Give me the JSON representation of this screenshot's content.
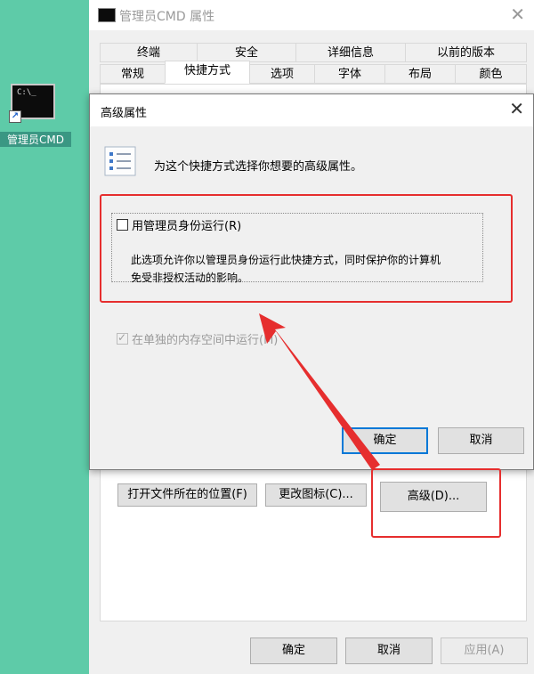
{
  "desktop": {
    "shortcut_label": "管理员CMD",
    "shortcut_thumb_text": "C:\\_"
  },
  "properties": {
    "title": "管理员CMD 属性",
    "tabs_row1": [
      "终端",
      "安全",
      "详细信息",
      "以前的版本"
    ],
    "tabs_row2": [
      "常规",
      "快捷方式",
      "选项",
      "字体",
      "布局",
      "颜色"
    ],
    "selected_tab": "快捷方式",
    "open_location_button": "打开文件所在的位置(F)",
    "change_icon_button": "更改图标(C)...",
    "advanced_button": "高级(D)...",
    "ok_button": "确定",
    "cancel_button": "取消",
    "apply_button": "应用(A)"
  },
  "advanced": {
    "title": "高级属性",
    "description": "为这个快捷方式选择你想要的高级属性。",
    "run_as_admin_label": "用管理员身份运行(R)",
    "run_as_admin_checked": false,
    "explain_line1": "此选项允许你以管理员身份运行此快捷方式，同时保护你的计算机",
    "explain_line2": "免受非授权活动的影响。",
    "separate_memory_label": "在单独的内存空间中运行(M)",
    "separate_memory_checked": true,
    "separate_memory_enabled": false,
    "ok_button": "确定",
    "cancel_button": "取消"
  },
  "colors": {
    "desktop": "#5ecba8",
    "annotation_red": "#e62e2e",
    "focus_blue": "#0078d7"
  }
}
